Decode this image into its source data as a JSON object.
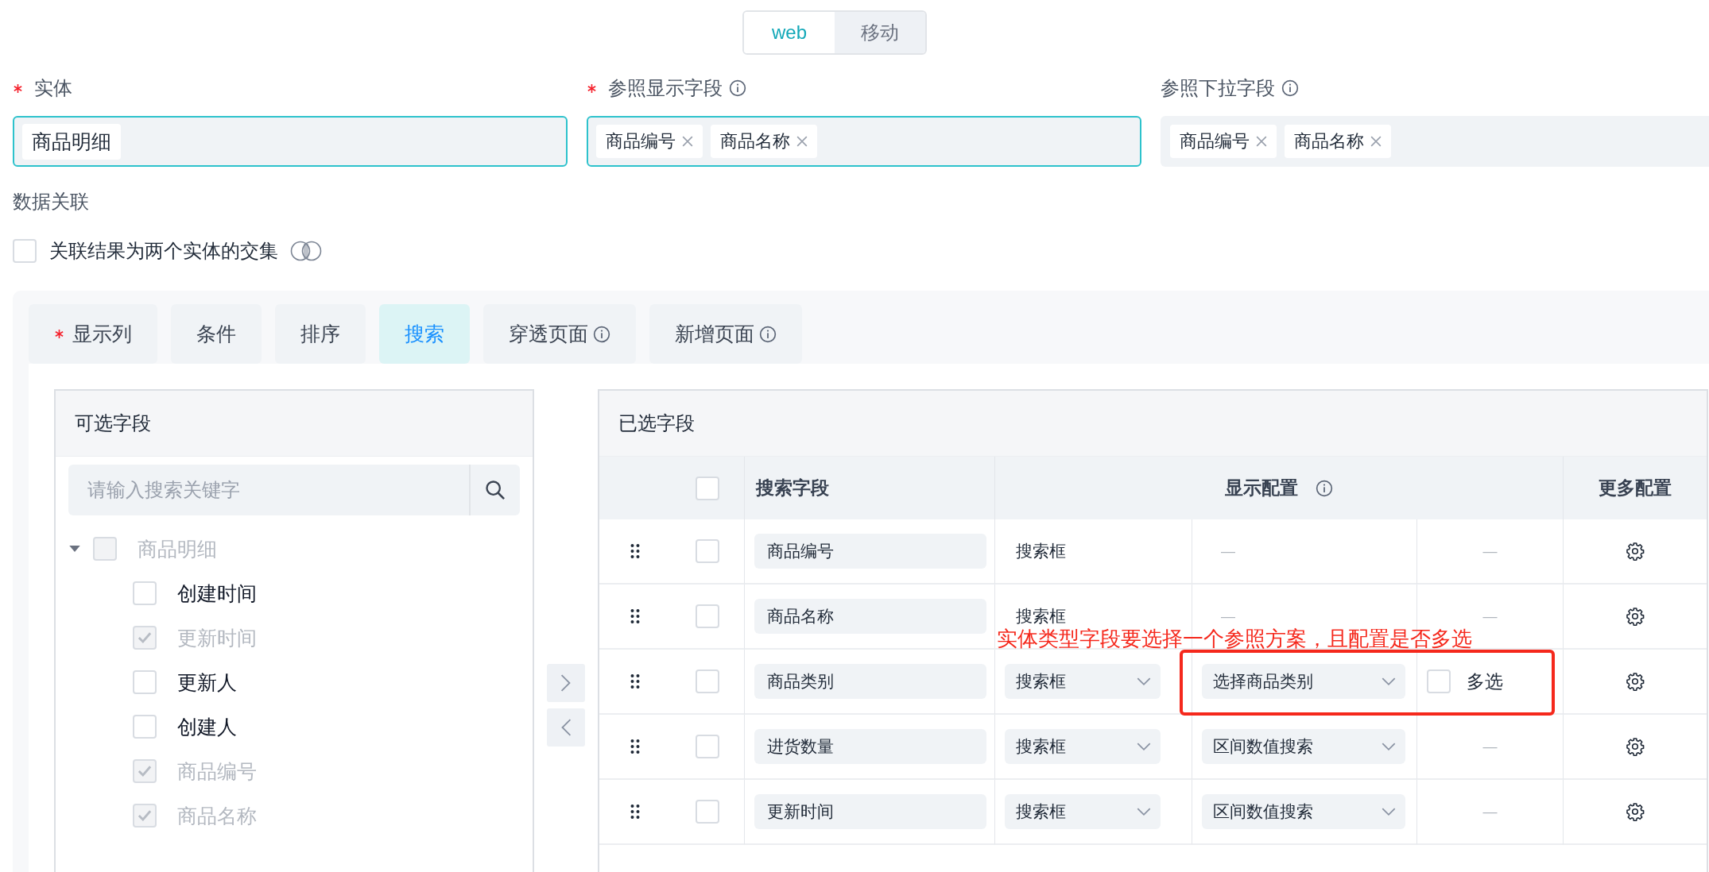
{
  "platform_switch": [
    {
      "label": "web",
      "selected": true
    },
    {
      "label": "移动",
      "selected": false
    }
  ],
  "form_fields": [
    {
      "label": "实体",
      "required": true,
      "info": false,
      "focused": true,
      "removable": false,
      "tags": [
        "商品明细"
      ]
    },
    {
      "label": "参照显示字段",
      "required": true,
      "info": true,
      "focused": true,
      "removable": true,
      "tags": [
        "商品编号",
        "商品名称"
      ]
    },
    {
      "label": "参照下拉字段",
      "required": false,
      "info": true,
      "focused": false,
      "removable": true,
      "tags": [
        "商品编号",
        "商品名称"
      ]
    }
  ],
  "data_relation": {
    "title": "数据关联",
    "intersection": {
      "label": "关联结果为两个实体的交集",
      "checked": false
    }
  },
  "tabs": [
    {
      "label": "显示列",
      "required": true,
      "info": false,
      "selected": false
    },
    {
      "label": "条件",
      "required": false,
      "info": false,
      "selected": false
    },
    {
      "label": "排序",
      "required": false,
      "info": false,
      "selected": false
    },
    {
      "label": "搜索",
      "required": false,
      "info": false,
      "selected": true
    },
    {
      "label": "穿透页面",
      "required": false,
      "info": true,
      "selected": false
    },
    {
      "label": "新增页面",
      "required": false,
      "info": true,
      "selected": false
    }
  ],
  "available_fields": {
    "title": "可选字段",
    "search": {
      "placeholder": "请输入搜索关键字"
    },
    "tree": [
      {
        "label": "商品明细",
        "checked": false,
        "disabled": true,
        "expanded": true,
        "children": [
          {
            "label": "创建时间",
            "checked": false,
            "disabled": false
          },
          {
            "label": "更新时间",
            "checked": true,
            "disabled": true
          },
          {
            "label": "更新人",
            "checked": false,
            "disabled": false
          },
          {
            "label": "创建人",
            "checked": false,
            "disabled": false
          },
          {
            "label": "商品编号",
            "checked": true,
            "disabled": true
          },
          {
            "label": "商品名称",
            "checked": true,
            "disabled": true
          }
        ]
      }
    ]
  },
  "selected_fields": {
    "title": "已选字段",
    "header_checked": false,
    "columns": {
      "field": "搜索字段",
      "display": "显示配置",
      "display_info": true,
      "more": "更多配置"
    },
    "rows": [
      {
        "field": "商品编号",
        "checked": false,
        "control": {
          "kind": "text",
          "value": "搜索框"
        },
        "source": {
          "kind": "dash",
          "value": "—"
        },
        "multi": {
          "kind": "dash",
          "value": "—"
        }
      },
      {
        "field": "商品名称",
        "checked": false,
        "control": {
          "kind": "text",
          "value": "搜索框"
        },
        "source": {
          "kind": "dash",
          "value": "—"
        },
        "multi": {
          "kind": "dash",
          "value": "—"
        }
      },
      {
        "field": "商品类别",
        "checked": false,
        "control": {
          "kind": "select",
          "value": "搜索框"
        },
        "source": {
          "kind": "select",
          "value": "选择商品类别"
        },
        "multi": {
          "kind": "checkbox",
          "value": "多选",
          "checked": false
        }
      },
      {
        "field": "进货数量",
        "checked": false,
        "control": {
          "kind": "select",
          "value": "搜索框"
        },
        "source": {
          "kind": "select",
          "value": "区间数值搜索"
        },
        "multi": {
          "kind": "dash",
          "value": "—"
        }
      },
      {
        "field": "更新时间",
        "checked": false,
        "control": {
          "kind": "select",
          "value": "搜索框"
        },
        "source": {
          "kind": "select",
          "value": "区间数值搜索"
        },
        "multi": {
          "kind": "dash",
          "value": "—"
        }
      }
    ]
  },
  "annotation": {
    "text": "实体类型字段要选择一个参照方案，且配置是否多选"
  }
}
